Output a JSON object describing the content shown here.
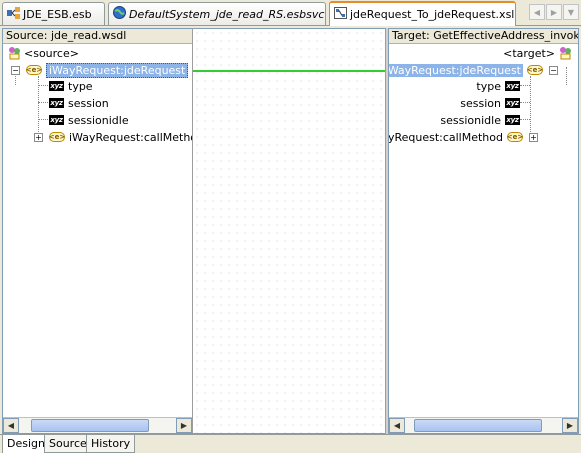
{
  "tabs": [
    {
      "label": "JDE_ESB.esb",
      "icon": "esb-diagram-icon"
    },
    {
      "label": "DefaultSystem_jde_read_RS.esbsvc",
      "icon": "globe-service-icon"
    },
    {
      "label": "jdeRequest_To_jdeRequest.xsl",
      "icon": "xsl-map-icon"
    }
  ],
  "source": {
    "header": "Source: jde_read.wsdl",
    "root_label": "<source>",
    "tree": {
      "element": "iWayRequest:jdeRequest",
      "children": [
        "type",
        "session",
        "sessionidle"
      ],
      "sibling": "iWayRequest:callMethod"
    }
  },
  "target": {
    "header": "Target: GetEffectiveAddress_invoke.w",
    "root_label": "<target>",
    "tree": {
      "element": "iWayRequest:jdeRequest",
      "children": [
        "type",
        "session",
        "sessionidle"
      ],
      "sibling": "iWayRequest:callMethod"
    }
  },
  "icons": {
    "attr_icon_text": "xyz",
    "element_icon_text": "<e>"
  },
  "mapping": {
    "line_color": "#33cc33"
  },
  "bottom_tabs": [
    "Design",
    "Source",
    "History"
  ]
}
